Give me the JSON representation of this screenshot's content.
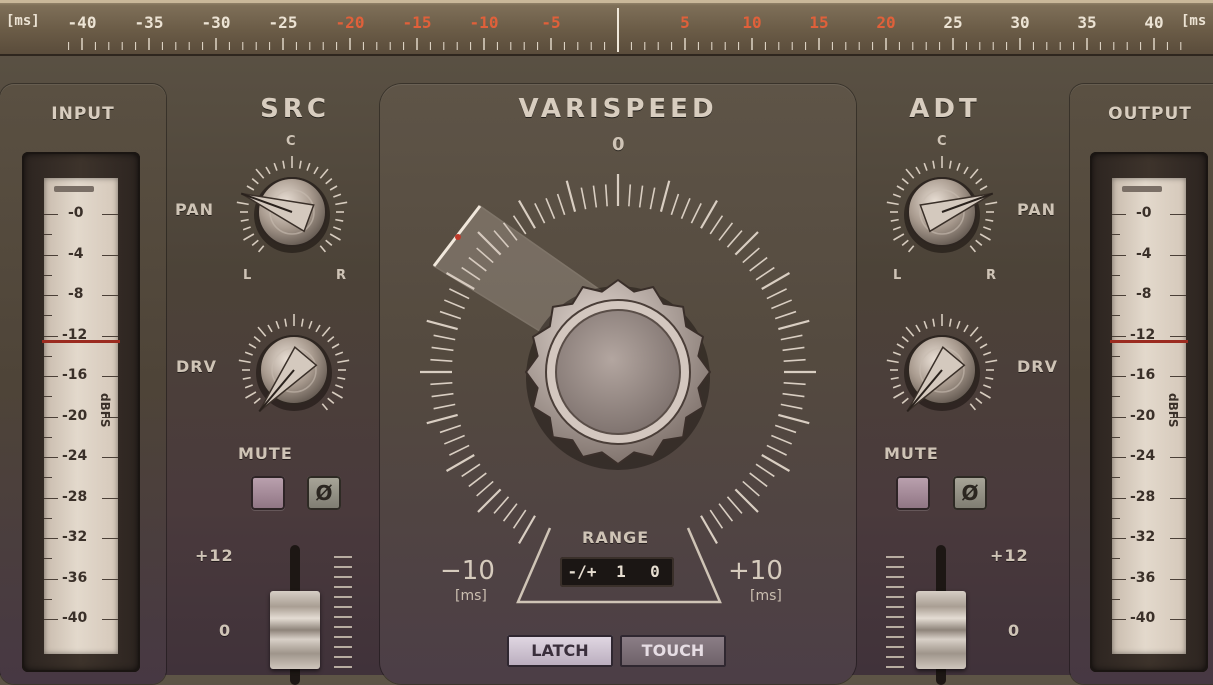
{
  "ruler": {
    "left_unit": "[ms]",
    "right_unit": "[ms",
    "labels": [
      "-40",
      "-35",
      "-30",
      "-25",
      "-20",
      "-15",
      "-10",
      "-5",
      "5",
      "10",
      "15",
      "20",
      "25",
      "30",
      "35",
      "40"
    ],
    "highlight_color": "#e0603a",
    "label_color": "#ece3d4"
  },
  "input": {
    "title": "INPUT",
    "scale": [
      "0",
      "4",
      "8",
      "12",
      "16",
      "20",
      "24",
      "28",
      "32",
      "36",
      "40"
    ],
    "unit": "dBFS"
  },
  "output": {
    "title": "OUTPUT",
    "scale": [
      "0",
      "4",
      "8",
      "12",
      "16",
      "20",
      "24",
      "28",
      "32",
      "36",
      "40"
    ],
    "unit": "dBFS"
  },
  "src": {
    "title": "SRC",
    "pan_label": "PAN",
    "pan_center": "C",
    "pan_left": "L",
    "pan_right": "R",
    "drv_label": "DRV",
    "mute_label": "MUTE",
    "phase_symbol": "Ø",
    "fader_top": "+12",
    "fader_zero": "0"
  },
  "adt": {
    "title": "ADT",
    "pan_label": "PAN",
    "pan_center": "C",
    "pan_left": "L",
    "pan_right": "R",
    "drv_label": "DRV",
    "mute_label": "MUTE",
    "phase_symbol": "Ø",
    "fader_top": "+12",
    "fader_zero": "0"
  },
  "varispeed": {
    "title": "VARISPEED",
    "center_label": "0",
    "min_label": "−10",
    "max_label": "+10",
    "min_unit": "[ms]",
    "max_unit": "[ms]",
    "range_label": "RANGE",
    "range_values": [
      "-/+",
      "1",
      "0"
    ],
    "latch_label": "LATCH",
    "touch_label": "TOUCH"
  }
}
